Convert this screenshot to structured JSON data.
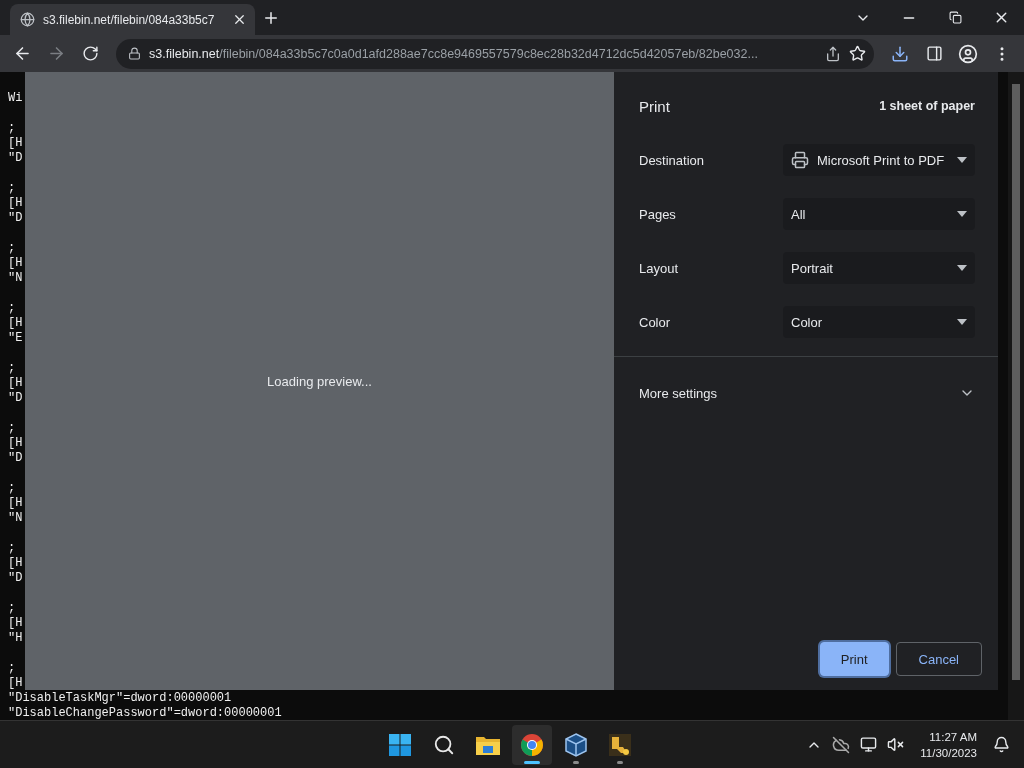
{
  "browser": {
    "tab": {
      "title": "s3.filebin.net/filebin/084a33b5c7"
    },
    "address": {
      "host": "s3.filebin.net",
      "path": "/filebin/084a33b5c7c0a0d1afd288ae7cc8e9469557579c8ec28b32d4712dc5d42057eb/82be032..."
    }
  },
  "page_text": {
    "first_line": "Wi",
    "blocks": [
      [
        ";",
        "[H",
        "\"D"
      ],
      [
        ";",
        "[H",
        "\"D"
      ],
      [
        ";",
        "[H",
        "\"N"
      ],
      [
        ";",
        "[H",
        "\"E"
      ],
      [
        ";",
        "[H",
        "\"D"
      ],
      [
        ";",
        "[H",
        "\"D"
      ],
      [
        ";",
        "[H",
        "\"N"
      ],
      [
        ";",
        "[H",
        "\"D"
      ],
      [
        ";",
        "[H",
        "\"H"
      ],
      [
        ";",
        "[H",
        "\"DisableTaskMgr\"=dword:00000001",
        "\"DisableChangePassword\"=dword:00000001"
      ]
    ]
  },
  "print_dialog": {
    "preview": {
      "message": "Loading preview..."
    },
    "title": "Print",
    "summary": "1 sheet of paper",
    "settings": [
      {
        "label": "Destination",
        "value": "Microsoft Print to PDF",
        "kind": "printer"
      },
      {
        "label": "Pages",
        "value": "All",
        "kind": "plain"
      },
      {
        "label": "Layout",
        "value": "Portrait",
        "kind": "plain"
      },
      {
        "label": "Color",
        "value": "Color",
        "kind": "plain"
      }
    ],
    "more_settings": {
      "label": "More settings",
      "expanded": false
    },
    "buttons": [
      {
        "label": "Print",
        "kind": "primary"
      },
      {
        "label": "Cancel",
        "kind": "secondary"
      }
    ]
  },
  "taskbar": {
    "apps": [
      {
        "kind": "start",
        "selected": false,
        "running": false
      },
      {
        "kind": "search",
        "selected": false,
        "running": false
      },
      {
        "kind": "files",
        "selected": false,
        "running": false
      },
      {
        "kind": "browser",
        "selected": true,
        "running": true
      },
      {
        "kind": "cube",
        "selected": false,
        "running": true
      },
      {
        "kind": "tool",
        "selected": false,
        "running": true
      }
    ],
    "clock": {
      "time": "11:27 AM",
      "date": "11/30/2023"
    }
  }
}
